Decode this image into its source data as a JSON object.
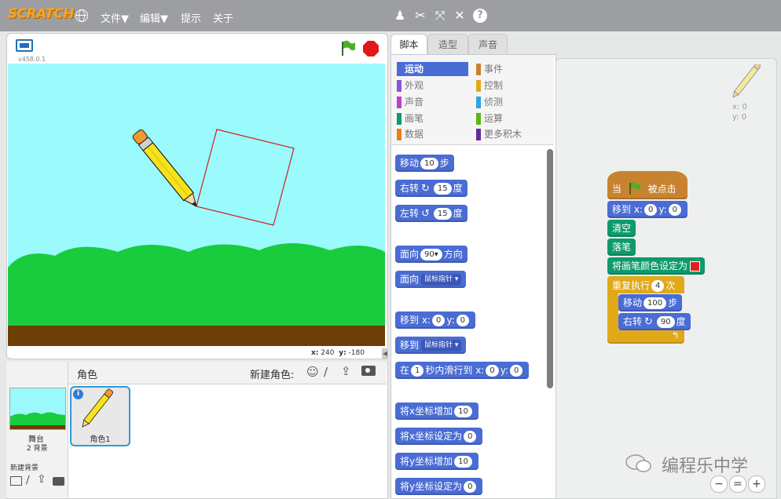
{
  "menubar": {
    "logo": "SCRATCH",
    "globe_icon": "globe-icon",
    "menus": [
      "文件▼",
      "编辑▼",
      "提示",
      "关于"
    ],
    "tools": [
      "duplicate-icon",
      "cut-icon",
      "grow-icon",
      "shrink-icon",
      "help-icon"
    ]
  },
  "stage": {
    "version": "v458.0.1",
    "x_label": "x:",
    "x_value": "240",
    "y_label": "y:",
    "y_value": "-180"
  },
  "sprites": {
    "header": "角色",
    "new_sprite_label": "新建角色:",
    "stage_label": "舞台",
    "stage_backdrops": "2 背景",
    "new_backdrop_label": "新建背景",
    "sprite_name": "角色1"
  },
  "tabs": [
    "脚本",
    "造型",
    "声音"
  ],
  "categories": {
    "left": [
      {
        "label": "运动",
        "color": "#4a6cd4"
      },
      {
        "label": "外观",
        "color": "#8a55d7"
      },
      {
        "label": "声音",
        "color": "#bb42c3"
      },
      {
        "label": "画笔",
        "color": "#0e9a6c"
      },
      {
        "label": "数据",
        "color": "#ee7d16"
      }
    ],
    "right": [
      {
        "label": "事件",
        "color": "#c88330"
      },
      {
        "label": "控制",
        "color": "#e1a91a"
      },
      {
        "label": "侦测",
        "color": "#2ca5e2"
      },
      {
        "label": "运算",
        "color": "#5cb712"
      },
      {
        "label": "更多积木",
        "color": "#632d99"
      }
    ]
  },
  "palette": {
    "move": {
      "pre": "移动",
      "val": "10",
      "post": "步"
    },
    "turn_right": {
      "pre": "右转",
      "val": "15",
      "post": "度"
    },
    "turn_left": {
      "pre": "左转",
      "val": "15",
      "post": "度"
    },
    "point_dir": {
      "pre": "面向",
      "val": "90▾",
      "post": "方向"
    },
    "point_towards": {
      "pre": "面向",
      "drop": "鼠标指针 ▾"
    },
    "goto_xy": {
      "pre": "移到 x:",
      "x": "0",
      "mid": "y:",
      "y": "0"
    },
    "goto": {
      "pre": "移到",
      "drop": "鼠标指针 ▾"
    },
    "glide": {
      "pre": "在",
      "secs": "1",
      "mid": "秒内滑行到 x:",
      "x": "0",
      "ylab": "y:",
      "y": "0"
    },
    "change_x": {
      "pre": "将x坐标增加",
      "val": "10"
    },
    "set_x": {
      "pre": "将x坐标设定为",
      "val": "0"
    },
    "change_y": {
      "pre": "将y坐标增加",
      "val": "10"
    },
    "set_y": {
      "pre": "将y坐标设定为",
      "val": "0"
    }
  },
  "script": {
    "sprite_x": "x: 0",
    "sprite_y": "y: 0",
    "hat_pre": "当",
    "hat_post": "被点击",
    "goto_pre": "移到 x:",
    "goto_x": "0",
    "goto_mid": "y:",
    "goto_y": "0",
    "clear": "清空",
    "pen_down": "落笔",
    "set_color": "将画笔颜色设定为",
    "pen_color": "#e02020",
    "repeat_pre": "重复执行",
    "repeat_val": "4",
    "repeat_post": "次",
    "move_pre": "移动",
    "move_val": "100",
    "move_post": "步",
    "turn_pre": "右转",
    "turn_val": "90",
    "turn_post": "度"
  },
  "watermark": "编程乐中学",
  "zoom": [
    "zoom-out-icon",
    "zoom-reset-icon",
    "zoom-in-icon"
  ]
}
